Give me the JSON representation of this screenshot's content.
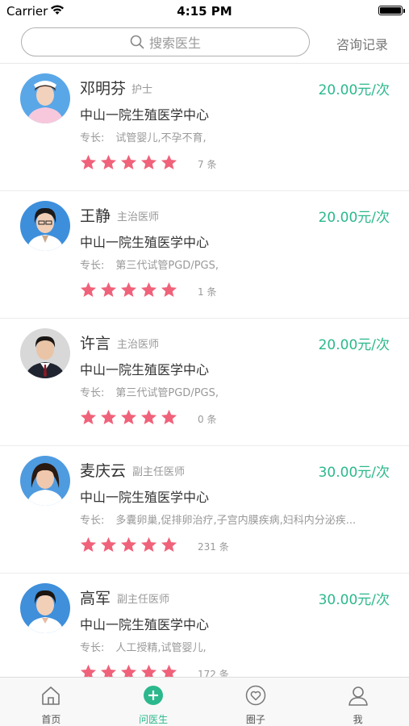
{
  "status_bar": {
    "carrier": "Carrier",
    "time": "4:15 PM",
    "battery_level": 1.0
  },
  "search": {
    "placeholder": "搜索医生",
    "history_label": "咨询记录"
  },
  "colors": {
    "accent": "#2bb88c",
    "star": "#f0627a",
    "muted": "#999999"
  },
  "doctors": [
    {
      "name": "邓明芬",
      "title": "护士",
      "price": "20.00元/次",
      "hospital": "中山一院生殖医学中心",
      "specialty_label": "专长:",
      "specialty": "试管婴儿,不孕不育,",
      "rating": 5,
      "review_count": "7 条"
    },
    {
      "name": "王静",
      "title": "主治医师",
      "price": "20.00元/次",
      "hospital": "中山一院生殖医学中心",
      "specialty_label": "专长:",
      "specialty": "第三代试管PGD/PGS,",
      "rating": 5,
      "review_count": "1 条"
    },
    {
      "name": "许言",
      "title": "主治医师",
      "price": "20.00元/次",
      "hospital": "中山一院生殖医学中心",
      "specialty_label": "专长:",
      "specialty": "第三代试管PGD/PGS,",
      "rating": 5,
      "review_count": "0 条"
    },
    {
      "name": "麦庆云",
      "title": "副主任医师",
      "price": "30.00元/次",
      "hospital": "中山一院生殖医学中心",
      "specialty_label": "专长:",
      "specialty": "多囊卵巢,促排卵治疗,子宫内膜疾病,妇科内分泌疾...",
      "rating": 5,
      "review_count": "231 条"
    },
    {
      "name": "高军",
      "title": "副主任医师",
      "price": "30.00元/次",
      "hospital": "中山一院生殖医学中心",
      "specialty_label": "专长:",
      "specialty": "人工授精,试管婴儿,",
      "rating": 5,
      "review_count": "172 条"
    }
  ],
  "tabs": [
    {
      "label": "首页",
      "icon": "home-icon",
      "active": false
    },
    {
      "label": "问医生",
      "icon": "plus-circle-icon",
      "active": true
    },
    {
      "label": "圈子",
      "icon": "heart-icon",
      "active": false
    },
    {
      "label": "我",
      "icon": "user-icon",
      "active": false
    }
  ]
}
